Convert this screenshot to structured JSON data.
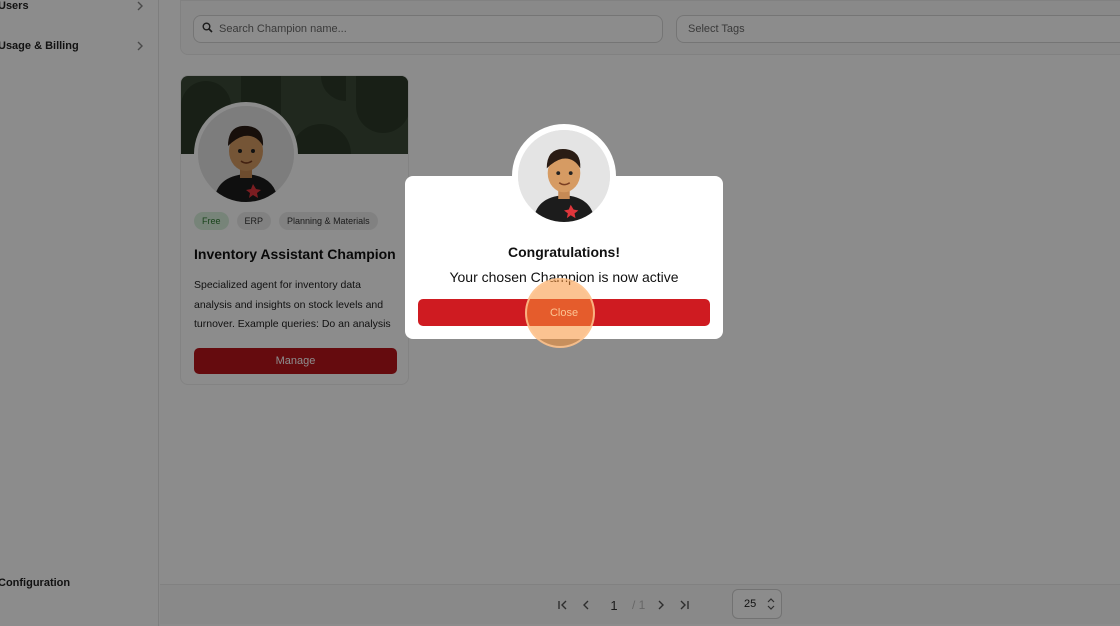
{
  "sidebar": {
    "items": [
      {
        "label": "Users"
      },
      {
        "label": "Usage & Billing"
      }
    ],
    "bottom_items": [
      {
        "label": "Configuration"
      }
    ]
  },
  "search": {
    "placeholder": "Search Champion name..."
  },
  "tags": {
    "placeholder": "Select Tags"
  },
  "card": {
    "badges": [
      "Free",
      "ERP",
      "Planning & Materials"
    ],
    "title": "Inventory Assistant Champion",
    "description": "Specialized agent for inventory data analysis and insights on stock levels and turnover. Example queries: Do an analysis",
    "manage_label": "Manage"
  },
  "pagination": {
    "current_page": "1",
    "total_pages": "/ 1",
    "per_page": "25"
  },
  "modal": {
    "title": "Congratulations!",
    "message": "Your chosen Champion is now active",
    "close_label": "Close"
  },
  "colors": {
    "accent": "#cf1b21",
    "manage_button": "#b8141b",
    "banner": "#3b4a37",
    "free_badge_bg": "#d9f0dc",
    "click_halo": "#f79236"
  },
  "icons": {
    "search": "search-icon",
    "chevron": "chevron-right-icon",
    "first": "first-page-icon",
    "prev": "previous-page-icon",
    "next": "next-page-icon",
    "last": "last-page-icon",
    "stepper": "stepper-icon"
  }
}
